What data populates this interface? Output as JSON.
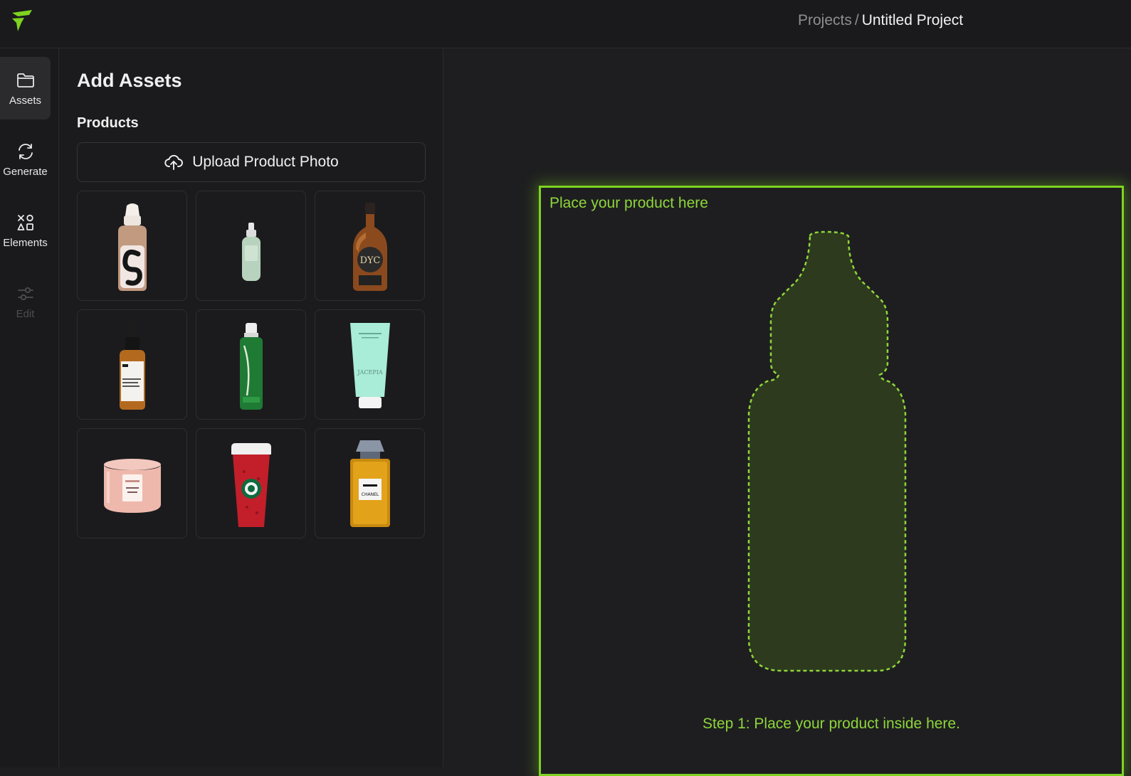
{
  "app": {
    "logo_icon": "brand-logo-icon",
    "accent_color": "#7ed321"
  },
  "breadcrumb": {
    "root": "Projects",
    "separator": "/",
    "current": "Untitled Project"
  },
  "rail": {
    "items": [
      {
        "label": "Assets",
        "icon": "folder-icon",
        "state": "active"
      },
      {
        "label": "Generate",
        "icon": "refresh-icon",
        "state": "normal"
      },
      {
        "label": "Elements",
        "icon": "shapes-icon",
        "state": "normal"
      },
      {
        "label": "Edit",
        "icon": "sliders-icon",
        "state": "disabled"
      }
    ]
  },
  "panel": {
    "title": "Add Assets",
    "section_title": "Products",
    "upload_label": "Upload Product Photo",
    "upload_icon": "cloud-upload-icon",
    "products": [
      {
        "icon": "foundation-bottle-icon"
      },
      {
        "icon": "spray-bottle-icon"
      },
      {
        "icon": "whisky-bottle-icon"
      },
      {
        "icon": "dropper-serum-icon"
      },
      {
        "icon": "green-bottle-icon"
      },
      {
        "icon": "cream-tube-icon"
      },
      {
        "icon": "candle-jar-icon"
      },
      {
        "icon": "coffee-cup-icon"
      },
      {
        "icon": "perfume-bottle-icon"
      }
    ]
  },
  "canvas": {
    "dropzone_title": "Place your product here",
    "step_text": "Step 1: Place your product inside here."
  }
}
